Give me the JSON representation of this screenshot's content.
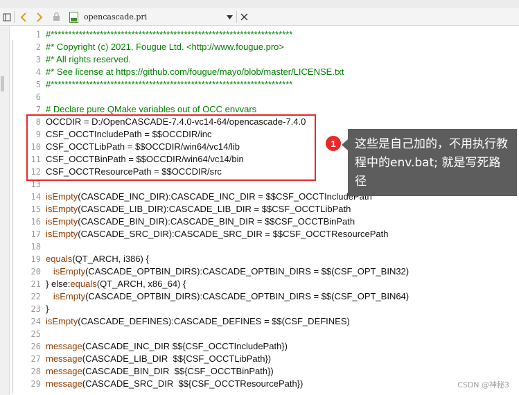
{
  "editor": {
    "tab_filename": "opencascade.pri",
    "icons": {
      "panel_toggle": "panel-toggle-icon",
      "back": "chevron-left-icon",
      "forward": "chevron-right-icon",
      "lock": "lock-icon",
      "file": "qmake-file-icon",
      "dropdown": "dropdown-arrow-icon",
      "split": "split-view-icon",
      "close": "close-icon"
    },
    "colors": {
      "comment": "#008000",
      "function": "#8f3d00",
      "accent_red": "#e8282b"
    }
  },
  "code_lines": [
    {
      "num": "1",
      "parts": [
        {
          "t": "#*********************************************************************",
          "c": "comment"
        }
      ]
    },
    {
      "num": "2",
      "parts": [
        {
          "t": "#* Copyright (c) 2021, Fougue Ltd. <http://www.fougue.pro>",
          "c": "comment"
        }
      ]
    },
    {
      "num": "3",
      "parts": [
        {
          "t": "#* All rights reserved.",
          "c": "comment"
        }
      ]
    },
    {
      "num": "4",
      "parts": [
        {
          "t": "#* See license at https://github.com/fougue/mayo/blob/master/LICENSE.txt",
          "c": "comment"
        }
      ]
    },
    {
      "num": "5",
      "parts": [
        {
          "t": "#*********************************************************************",
          "c": "comment"
        }
      ]
    },
    {
      "num": "6",
      "parts": []
    },
    {
      "num": "7",
      "parts": [
        {
          "t": "# Declare pure QMake variables out of OCC envvars",
          "c": "comment"
        }
      ]
    },
    {
      "num": "8",
      "parts": [
        {
          "t": "OCCDIR = D:/OpenCASCADE-7.4.0-vc14-64/opencascade-7.4.0",
          "c": ""
        }
      ]
    },
    {
      "num": "9",
      "parts": [
        {
          "t": "CSF_OCCTIncludePath = $$OCCDIR/inc",
          "c": ""
        }
      ]
    },
    {
      "num": "10",
      "parts": [
        {
          "t": "CSF_OCCTLibPath = $$OCCDIR/win64/vc14/lib",
          "c": ""
        }
      ]
    },
    {
      "num": "11",
      "parts": [
        {
          "t": "CSF_OCCTBinPath = $$OCCDIR/win64/vc14/bin",
          "c": ""
        }
      ]
    },
    {
      "num": "12",
      "parts": [
        {
          "t": "CSF_OCCTResourcePath = $$OCCDIR/src",
          "c": ""
        }
      ]
    },
    {
      "num": "13",
      "parts": []
    },
    {
      "num": "14",
      "parts": [
        {
          "t": "isEmpty",
          "c": "fn"
        },
        {
          "t": "(CASCADE_INC_DIR):CASCADE_INC_DIR = $$CSF_OCCTIncludePath",
          "c": ""
        }
      ]
    },
    {
      "num": "15",
      "parts": [
        {
          "t": "isEmpty",
          "c": "fn"
        },
        {
          "t": "(CASCADE_LIB_DIR):CASCADE_LIB_DIR = $$CSF_OCCTLibPath",
          "c": ""
        }
      ]
    },
    {
      "num": "16",
      "parts": [
        {
          "t": "isEmpty",
          "c": "fn"
        },
        {
          "t": "(CASCADE_BIN_DIR):CASCADE_BIN_DIR = $$CSF_OCCTBinPath",
          "c": ""
        }
      ]
    },
    {
      "num": "17",
      "parts": [
        {
          "t": "isEmpty",
          "c": "fn"
        },
        {
          "t": "(CASCADE_SRC_DIR):CASCADE_SRC_DIR = $$CSF_OCCTResourcePath",
          "c": ""
        }
      ]
    },
    {
      "num": "18",
      "parts": []
    },
    {
      "num": "19",
      "parts": [
        {
          "t": "equals",
          "c": "fn"
        },
        {
          "t": "(QT_ARCH, i386) {",
          "c": ""
        }
      ]
    },
    {
      "num": "20",
      "parts": [
        {
          "t": "   ",
          "c": ""
        },
        {
          "t": "isEmpty",
          "c": "fn"
        },
        {
          "t": "(CASCADE_OPTBIN_DIRS):CASCADE_OPTBIN_DIRS = $$(CSF_OPT_BIN32)",
          "c": ""
        }
      ]
    },
    {
      "num": "21",
      "parts": [
        {
          "t": "} else:",
          "c": ""
        },
        {
          "t": "equals",
          "c": "fn"
        },
        {
          "t": "(QT_ARCH, x86_64) {",
          "c": ""
        }
      ]
    },
    {
      "num": "22",
      "parts": [
        {
          "t": "   ",
          "c": ""
        },
        {
          "t": "isEmpty",
          "c": "fn"
        },
        {
          "t": "(CASCADE_OPTBIN_DIRS):CASCADE_OPTBIN_DIRS = $$(CSF_OPT_BIN64)",
          "c": ""
        }
      ]
    },
    {
      "num": "23",
      "parts": [
        {
          "t": "}",
          "c": ""
        }
      ]
    },
    {
      "num": "24",
      "parts": [
        {
          "t": "isEmpty",
          "c": "fn"
        },
        {
          "t": "(CASCADE_DEFINES):CASCADE_DEFINES = $$(CSF_DEFINES)",
          "c": ""
        }
      ]
    },
    {
      "num": "25",
      "parts": []
    },
    {
      "num": "26",
      "parts": [
        {
          "t": "message",
          "c": "fn"
        },
        {
          "t": "(CASCADE_INC_DIR $${CSF_OCCTIncludePath})",
          "c": ""
        }
      ]
    },
    {
      "num": "27",
      "parts": [
        {
          "t": "message",
          "c": "fn"
        },
        {
          "t": "(CASCADE_LIB_DIR  $${CSF_OCCTLibPath})",
          "c": ""
        }
      ]
    },
    {
      "num": "28",
      "parts": [
        {
          "t": "message",
          "c": "fn"
        },
        {
          "t": "(CASCADE_BIN_DIR  $${CSF_OCCTBinPath})",
          "c": ""
        }
      ]
    },
    {
      "num": "29",
      "parts": [
        {
          "t": "message",
          "c": "fn"
        },
        {
          "t": "(CASCADE_SRC_DIR  $${CSF_OCCTResourcePath})",
          "c": ""
        }
      ]
    }
  ],
  "annotation": {
    "badge_number": "1",
    "callout_text": "这些是自己加的，不用执行教程中的env.bat; 就是写死路径"
  },
  "watermark": "CSDN @神秘3"
}
